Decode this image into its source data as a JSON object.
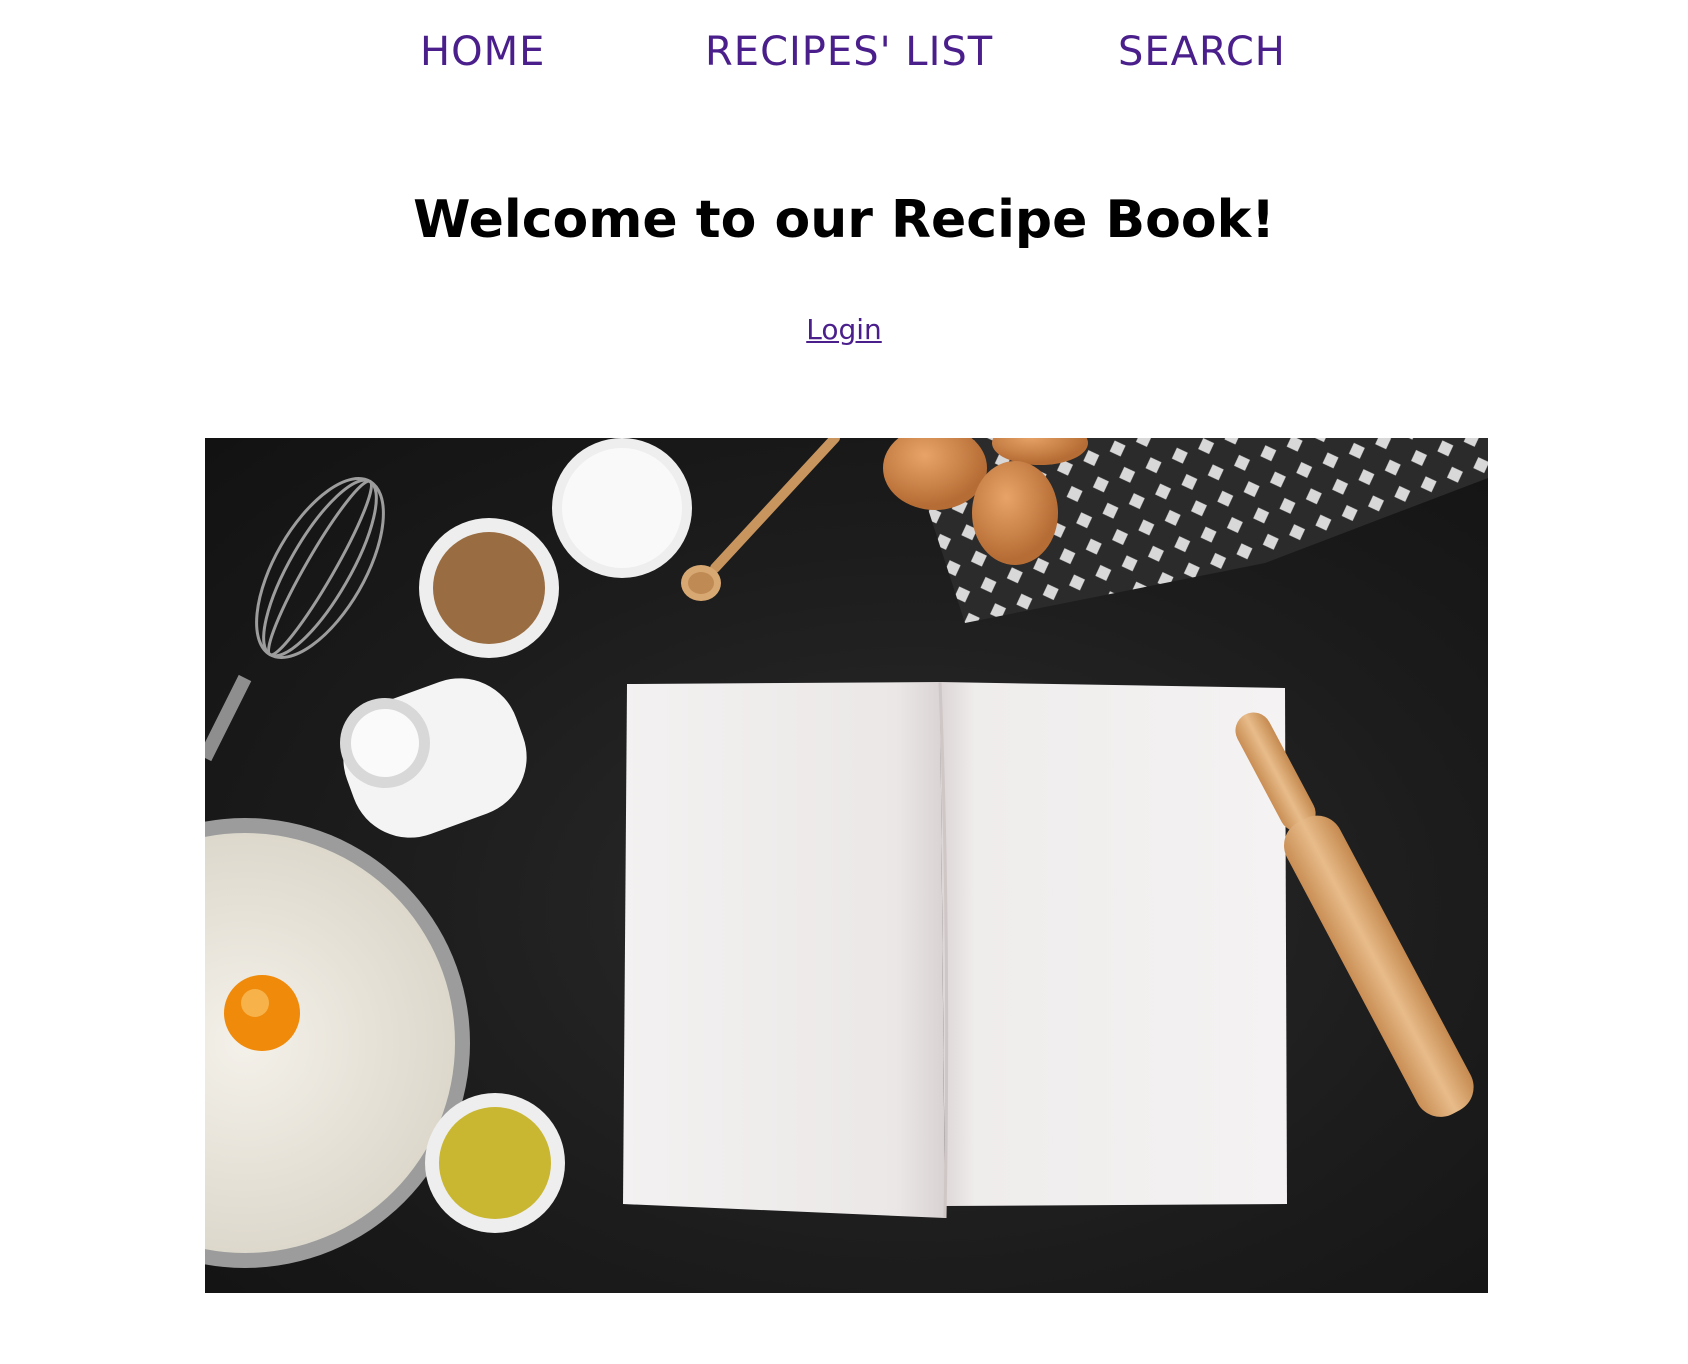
{
  "nav": {
    "items": [
      {
        "label": "HOME"
      },
      {
        "label": "RECIPES' LIST"
      },
      {
        "label": "SEARCH"
      }
    ]
  },
  "main": {
    "title": "Welcome to our Recipe Book!",
    "login_label": "Login"
  },
  "colors": {
    "nav_link": "#4a1f8c",
    "title": "#000000",
    "hero_background": "#1c1c1c"
  }
}
